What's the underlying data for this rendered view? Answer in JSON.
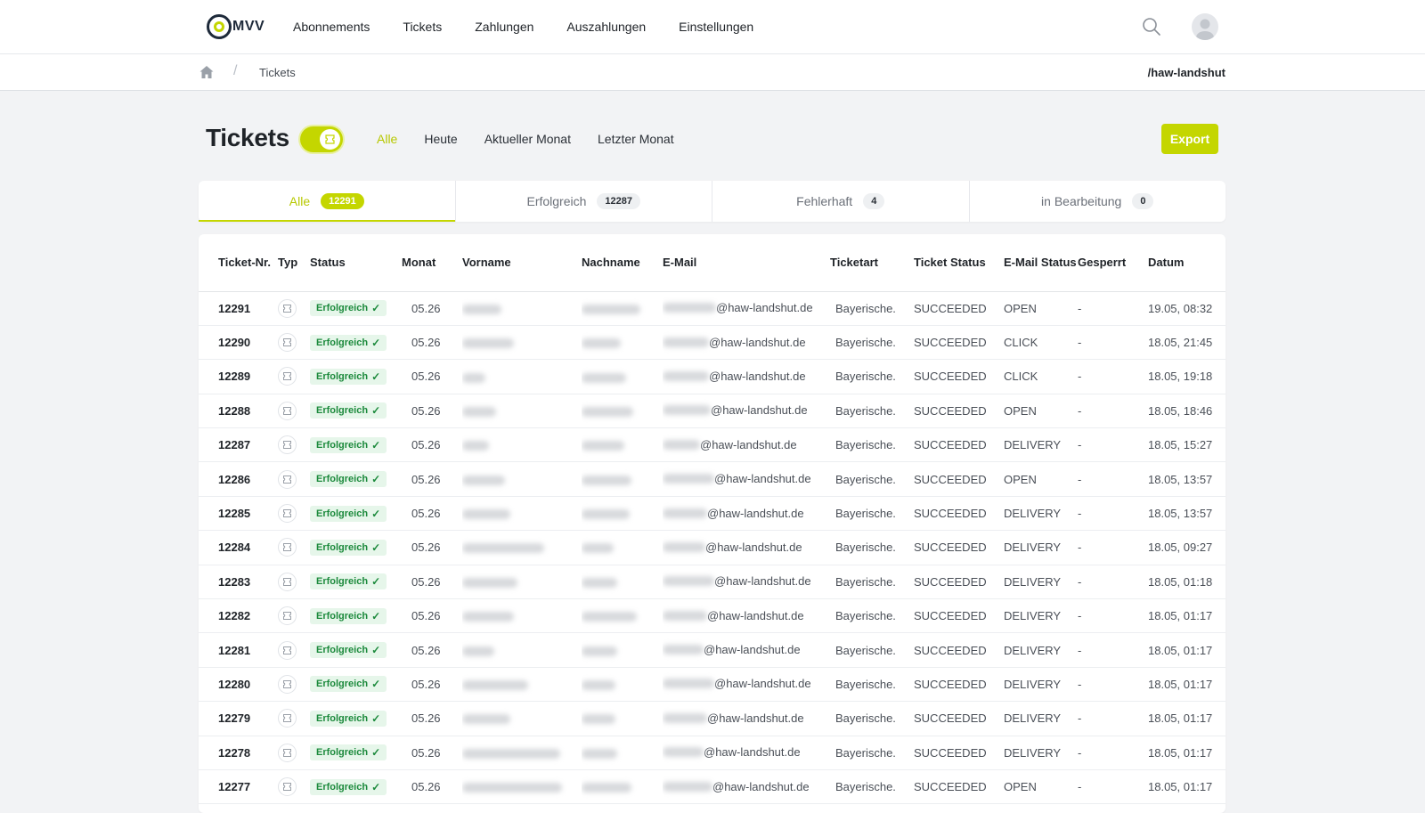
{
  "brand": {
    "logo_text": "MVV",
    "accent": "#c4d600"
  },
  "nav": {
    "items": [
      "Abonnements",
      "Tickets",
      "Zahlungen",
      "Auszahlungen",
      "Einstellungen"
    ]
  },
  "breadcrumb": {
    "current": "Tickets",
    "separator": "/",
    "tenant": "/haw-landshut"
  },
  "header": {
    "title": "Tickets",
    "range_filters": [
      {
        "label": "Alle",
        "active": true
      },
      {
        "label": "Heute",
        "active": false
      },
      {
        "label": "Aktueller Monat",
        "active": false
      },
      {
        "label": "Letzter Monat",
        "active": false
      }
    ],
    "export_label": "Export"
  },
  "tabs": [
    {
      "label": "Alle",
      "count": "12291",
      "active": true
    },
    {
      "label": "Erfolgreich",
      "count": "12287",
      "active": false
    },
    {
      "label": "Fehlerhaft",
      "count": "4",
      "active": false
    },
    {
      "label": "in Bearbeitung",
      "count": "0",
      "active": false
    }
  ],
  "table": {
    "columns": [
      "Ticket-Nr.",
      "Typ",
      "Status",
      "Monat",
      "Vorname",
      "Nachname",
      "E-Mail",
      "Ticketart",
      "Ticket Status",
      "E-Mail Status",
      "Gesperrt",
      "Datum"
    ],
    "rows": [
      {
        "nr": "12291",
        "status": "Erfolgreich",
        "monat": "05.26",
        "email_domain": "@haw-landshut.de",
        "ticketart": "Bayerische.",
        "ticket_status": "SUCCEEDED",
        "email_status": "OPEN",
        "gesperrt": "-",
        "datum": "19.05, 08:32"
      },
      {
        "nr": "12290",
        "status": "Erfolgreich",
        "monat": "05.26",
        "email_domain": "@haw-landshut.de",
        "ticketart": "Bayerische.",
        "ticket_status": "SUCCEEDED",
        "email_status": "CLICK",
        "gesperrt": "-",
        "datum": "18.05, 21:45"
      },
      {
        "nr": "12289",
        "status": "Erfolgreich",
        "monat": "05.26",
        "email_domain": "@haw-landshut.de",
        "ticketart": "Bayerische.",
        "ticket_status": "SUCCEEDED",
        "email_status": "CLICK",
        "gesperrt": "-",
        "datum": "18.05, 19:18"
      },
      {
        "nr": "12288",
        "status": "Erfolgreich",
        "monat": "05.26",
        "email_domain": "@haw-landshut.de",
        "ticketart": "Bayerische.",
        "ticket_status": "SUCCEEDED",
        "email_status": "OPEN",
        "gesperrt": "-",
        "datum": "18.05, 18:46"
      },
      {
        "nr": "12287",
        "status": "Erfolgreich",
        "monat": "05.26",
        "email_domain": "@haw-landshut.de",
        "ticketart": "Bayerische.",
        "ticket_status": "SUCCEEDED",
        "email_status": "DELIVERY",
        "gesperrt": "-",
        "datum": "18.05, 15:27"
      },
      {
        "nr": "12286",
        "status": "Erfolgreich",
        "monat": "05.26",
        "email_domain": "@haw-landshut.de",
        "ticketart": "Bayerische.",
        "ticket_status": "SUCCEEDED",
        "email_status": "OPEN",
        "gesperrt": "-",
        "datum": "18.05, 13:57"
      },
      {
        "nr": "12285",
        "status": "Erfolgreich",
        "monat": "05.26",
        "email_domain": "@haw-landshut.de",
        "ticketart": "Bayerische.",
        "ticket_status": "SUCCEEDED",
        "email_status": "DELIVERY",
        "gesperrt": "-",
        "datum": "18.05, 13:57"
      },
      {
        "nr": "12284",
        "status": "Erfolgreich",
        "monat": "05.26",
        "email_domain": "@haw-landshut.de",
        "ticketart": "Bayerische.",
        "ticket_status": "SUCCEEDED",
        "email_status": "DELIVERY",
        "gesperrt": "-",
        "datum": "18.05, 09:27"
      },
      {
        "nr": "12283",
        "status": "Erfolgreich",
        "monat": "05.26",
        "email_domain": "@haw-landshut.de",
        "ticketart": "Bayerische.",
        "ticket_status": "SUCCEEDED",
        "email_status": "DELIVERY",
        "gesperrt": "-",
        "datum": "18.05, 01:18"
      },
      {
        "nr": "12282",
        "status": "Erfolgreich",
        "monat": "05.26",
        "email_domain": "@haw-landshut.de",
        "ticketart": "Bayerische.",
        "ticket_status": "SUCCEEDED",
        "email_status": "DELIVERY",
        "gesperrt": "-",
        "datum": "18.05, 01:17"
      },
      {
        "nr": "12281",
        "status": "Erfolgreich",
        "monat": "05.26",
        "email_domain": "@haw-landshut.de",
        "ticketart": "Bayerische.",
        "ticket_status": "SUCCEEDED",
        "email_status": "DELIVERY",
        "gesperrt": "-",
        "datum": "18.05, 01:17"
      },
      {
        "nr": "12280",
        "status": "Erfolgreich",
        "monat": "05.26",
        "email_domain": "@haw-landshut.de",
        "ticketart": "Bayerische.",
        "ticket_status": "SUCCEEDED",
        "email_status": "DELIVERY",
        "gesperrt": "-",
        "datum": "18.05, 01:17"
      },
      {
        "nr": "12279",
        "status": "Erfolgreich",
        "monat": "05.26",
        "email_domain": "@haw-landshut.de",
        "ticketart": "Bayerische.",
        "ticket_status": "SUCCEEDED",
        "email_status": "DELIVERY",
        "gesperrt": "-",
        "datum": "18.05, 01:17"
      },
      {
        "nr": "12278",
        "status": "Erfolgreich",
        "monat": "05.26",
        "email_domain": "@haw-landshut.de",
        "ticketart": "Bayerische.",
        "ticket_status": "SUCCEEDED",
        "email_status": "DELIVERY",
        "gesperrt": "-",
        "datum": "18.05, 01:17"
      },
      {
        "nr": "12277",
        "status": "Erfolgreich",
        "monat": "05.26",
        "email_domain": "@haw-landshut.de",
        "ticketart": "Bayerische.",
        "ticket_status": "SUCCEEDED",
        "email_status": "OPEN",
        "gesperrt": "-",
        "datum": "18.05, 01:17"
      }
    ]
  }
}
